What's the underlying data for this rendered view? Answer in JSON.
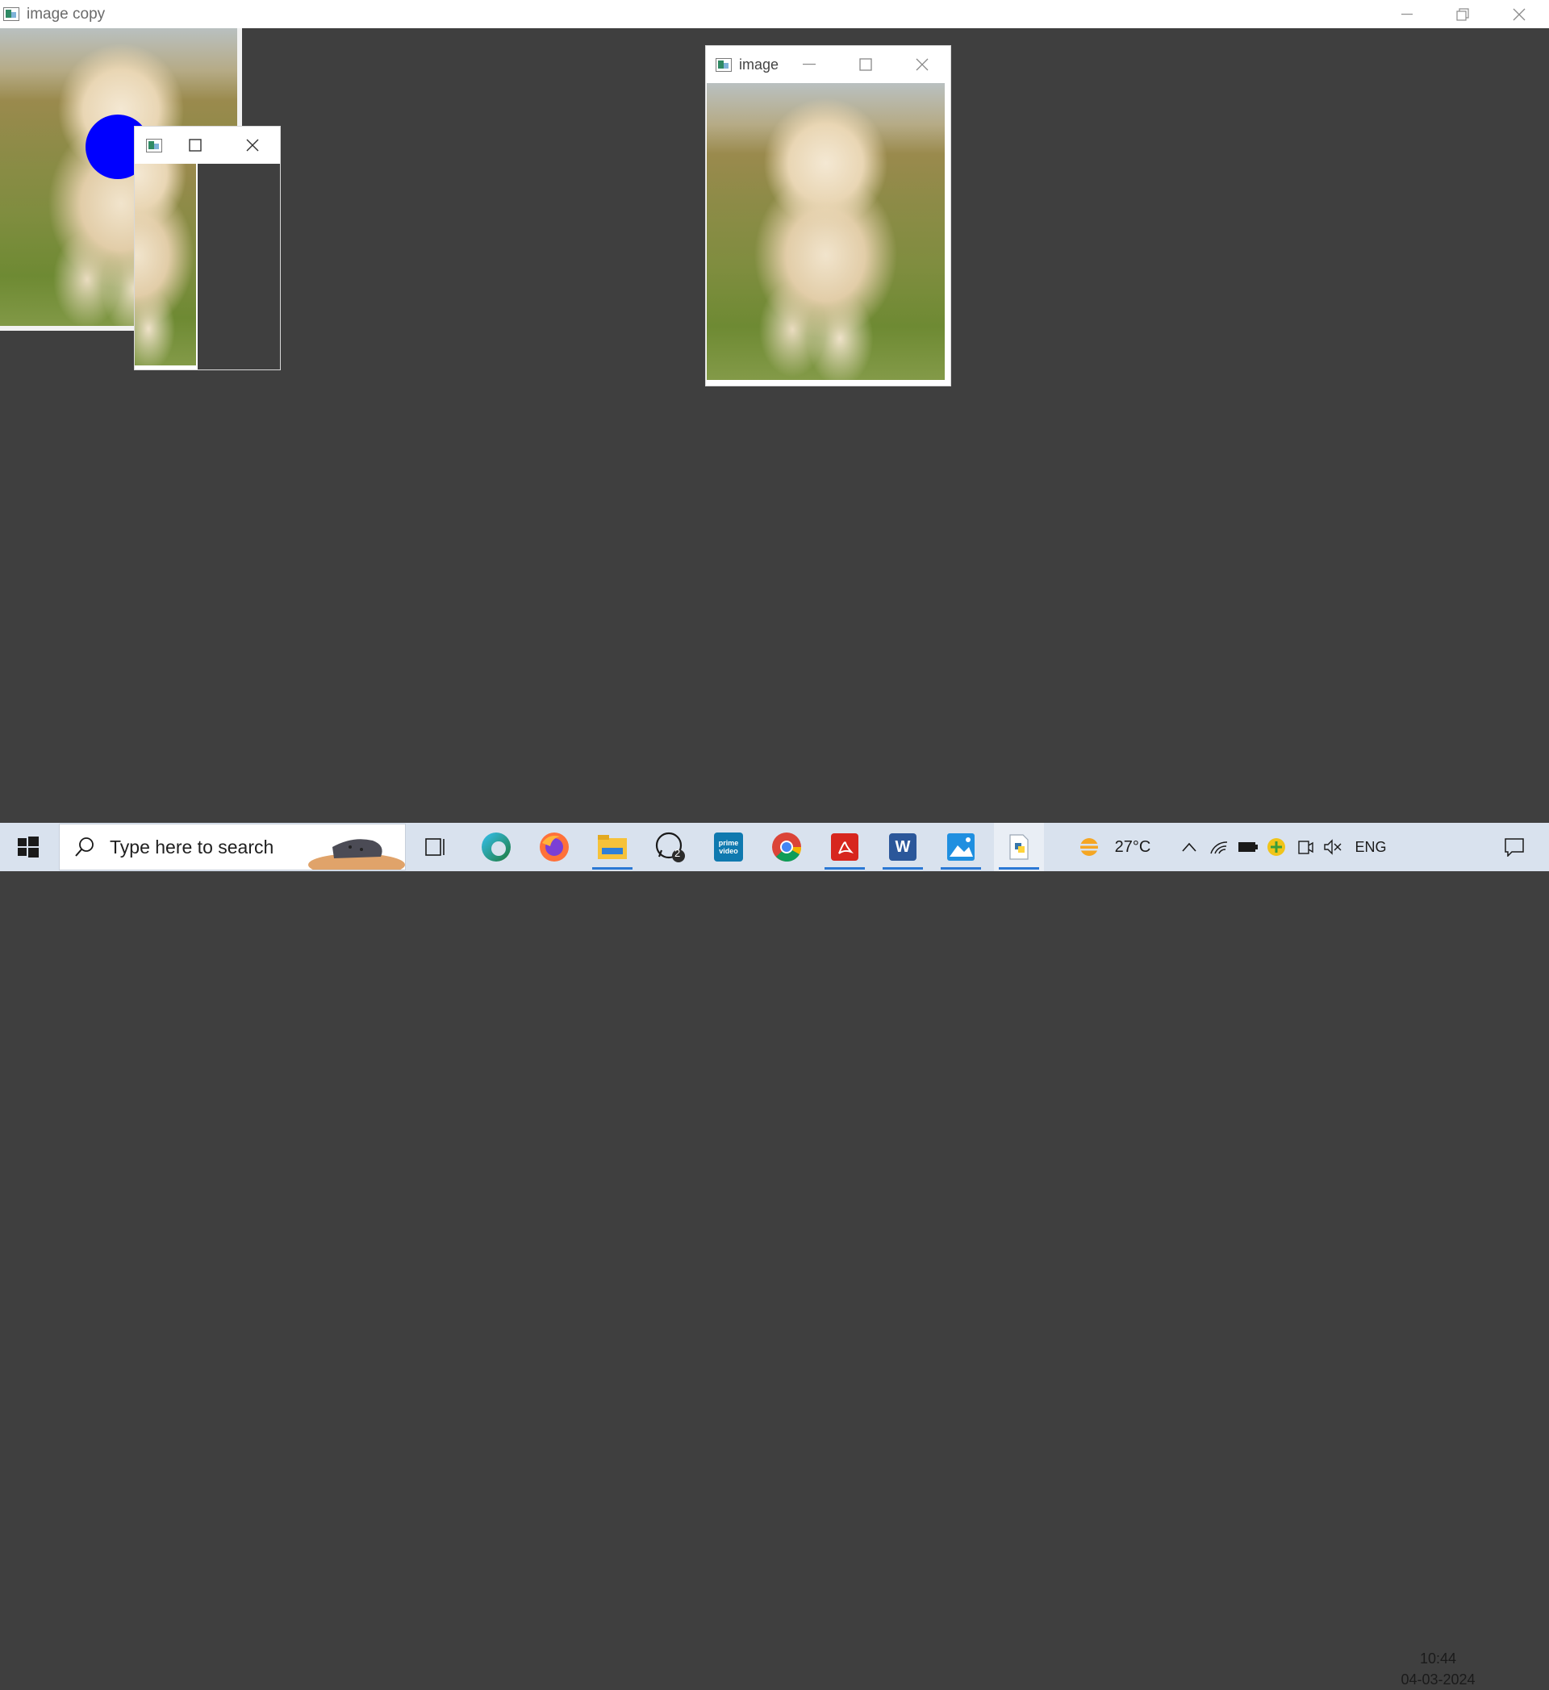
{
  "main_window": {
    "title": "image copy",
    "controls": [
      "minimize",
      "restore",
      "close"
    ]
  },
  "image_window": {
    "title": "image",
    "controls": [
      "minimize",
      "maximize",
      "close"
    ]
  },
  "small_window": {
    "title": "",
    "controls": [
      "maximize",
      "close"
    ]
  },
  "overlay": {
    "shape": "circle",
    "color": "#0000ff"
  },
  "taskbar": {
    "search_placeholder": "Type here to search",
    "apps": [
      {
        "name": "task-view",
        "active": false
      },
      {
        "name": "edge",
        "active": false
      },
      {
        "name": "firefox",
        "active": false
      },
      {
        "name": "file-explorer",
        "active": true
      },
      {
        "name": "whatsapp",
        "active": false,
        "badge": "2"
      },
      {
        "name": "prime-video",
        "active": false,
        "label": "prime video"
      },
      {
        "name": "chrome",
        "active": false
      },
      {
        "name": "acrobat",
        "active": true
      },
      {
        "name": "word",
        "active": true,
        "label": "W"
      },
      {
        "name": "photos",
        "active": true
      },
      {
        "name": "python",
        "active": true
      }
    ],
    "weather": {
      "temperature": "27°C"
    },
    "language": "ENG",
    "time": "10:44",
    "date": "04-03-2024"
  }
}
